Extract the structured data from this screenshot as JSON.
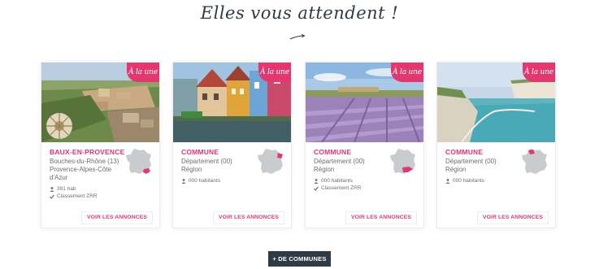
{
  "section": {
    "heading": "Elles vous attendent !"
  },
  "cards": [
    {
      "badge": "À la une",
      "name": "BAUX-EN-PROVENCE",
      "line1": "Bouches-du-Rhône (13)",
      "line2": "Provence-Alpes-Côte d'Azur",
      "population": "391 hab",
      "classement": "Classement ZRR",
      "button": "VOIR LES ANNONCES",
      "image": "village-on-rock-photo"
    },
    {
      "badge": "À la une",
      "name": "COMMUNE",
      "line1": "Département (00)",
      "line2": "Région",
      "population": "000 habitants",
      "classement": "",
      "button": "VOIR LES ANNONCES",
      "image": "colorful-canal-houses-photo"
    },
    {
      "badge": "À la une",
      "name": "COMMUNE",
      "line1": "Département (00)",
      "line2": "Région",
      "population": "000 habitants",
      "classement": "Classement ZRR",
      "button": "VOIR LES ANNONCES",
      "image": "lavender-field-photo"
    },
    {
      "badge": "À la une",
      "name": "COMMUNE",
      "line1": "Département (00)",
      "line2": "Région",
      "population": "000 habitants",
      "classement": "",
      "button": "VOIR LES ANNONCES",
      "image": "cliff-coastline-photo"
    }
  ],
  "more_button": "+ DE COMMUNES",
  "colors": {
    "accent": "#e2386f",
    "dark": "#2f3b44",
    "map_grey": "#c9cccf"
  }
}
